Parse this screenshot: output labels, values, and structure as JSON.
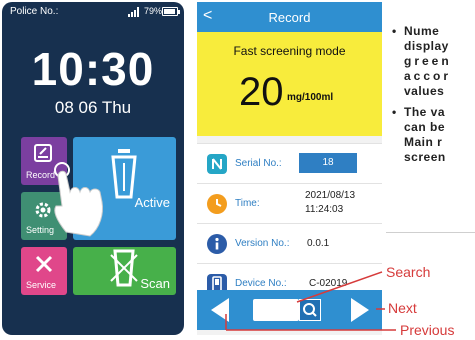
{
  "left_screen": {
    "status": {
      "label": "Police No.:",
      "battery": "79%"
    },
    "time": "10:30",
    "date": "08 06 Thu",
    "tiles": {
      "record": "Record",
      "setting": "Setting",
      "service": "Service",
      "active": "Active",
      "scan": "Scan"
    }
  },
  "right_screen": {
    "header": {
      "back": "<",
      "title": "Record"
    },
    "mode": "Fast screening mode",
    "value": "20",
    "unit": "mg/100ml",
    "serial": {
      "label": "Serial No.:",
      "value": "18"
    },
    "time": {
      "label": "Time:",
      "date": "2021/08/13",
      "clock": "11:24:03"
    },
    "version": {
      "label": "Version No.:",
      "value": "0.0.1"
    },
    "device": {
      "label": "Device No.:",
      "value": "C-02019"
    }
  },
  "callouts": {
    "search": "Search",
    "next": "Next",
    "previous": "Previous"
  },
  "notes": [
    {
      "lines": [
        "Nume",
        "display",
        "green",
        "accor",
        "values"
      ]
    },
    {
      "lines": [
        "The va",
        "can be",
        "Main r",
        "screen"
      ]
    }
  ],
  "colors": {
    "phone_bg": "#17304f",
    "accent_blue": "#2f8fd0",
    "highlight_yellow": "#f8ec3c",
    "callout_red": "#d63b3b"
  }
}
